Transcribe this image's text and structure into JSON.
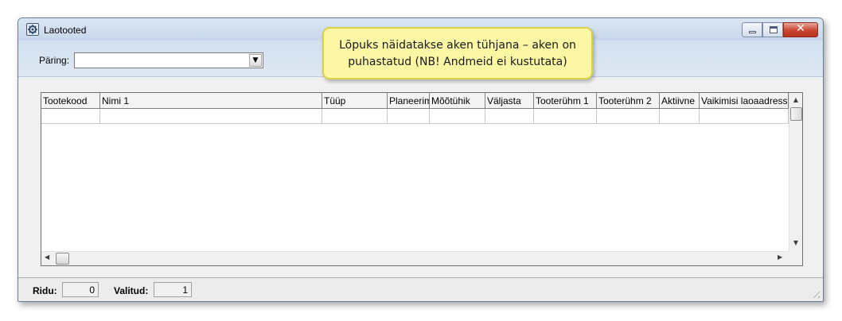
{
  "window": {
    "title": "Laotooted"
  },
  "query": {
    "label": "Päring:",
    "value": ""
  },
  "callout": {
    "line1": "Lõpuks näidatakse aken tühjana – aken on",
    "line2": "puhastatud (NB! Andmeid ei kustutata)"
  },
  "grid": {
    "columns": [
      {
        "label": "Tootekood"
      },
      {
        "label": "Nimi 1"
      },
      {
        "label": "Tüüp"
      },
      {
        "label": "Planeerim"
      },
      {
        "label": "Mõõtühik"
      },
      {
        "label": "Väljasta"
      },
      {
        "label": "Tooterühm 1"
      },
      {
        "label": "Tooterühm 2"
      },
      {
        "label": "Aktiivne"
      },
      {
        "label": "Vaikimisi laoaadress"
      }
    ],
    "rows": [
      [
        "",
        "",
        "",
        "",
        "",
        "",
        "",
        "",
        "",
        ""
      ]
    ]
  },
  "status": {
    "rows_label": "Ridu:",
    "rows_value": "0",
    "selected_label": "Valitud:",
    "selected_value": "1"
  },
  "icons": {
    "app": "gear-icon",
    "minimize": "minimize-icon",
    "maximize": "maximize-icon",
    "close": "close-icon",
    "combo": "chevron-down-icon"
  }
}
